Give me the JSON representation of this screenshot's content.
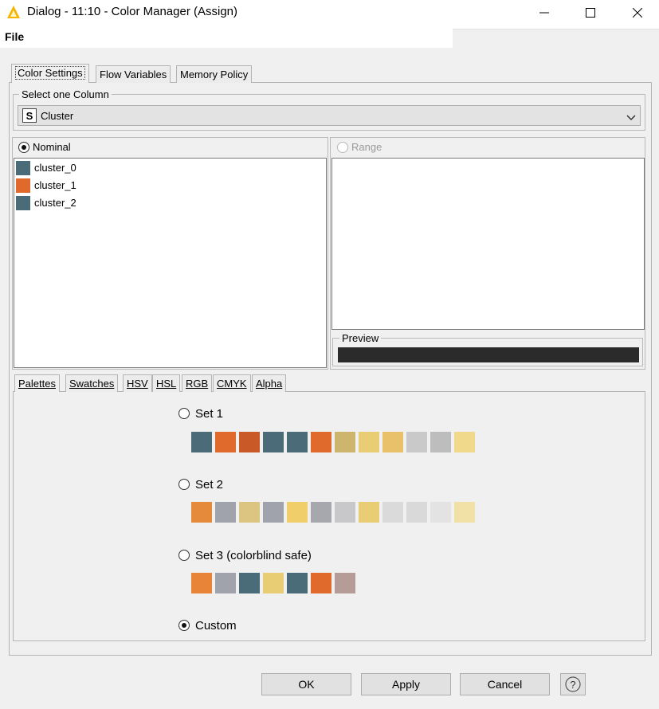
{
  "window": {
    "title": "Dialog - 11:10 - Color Manager (Assign)",
    "controls": [
      "minimize-icon",
      "maximize-icon",
      "close-icon"
    ]
  },
  "menu": {
    "file": "File"
  },
  "tabs": [
    {
      "label": "Color Settings",
      "active": true
    },
    {
      "label": "Flow Variables",
      "active": false
    },
    {
      "label": "Memory Policy",
      "active": false
    }
  ],
  "select_column": {
    "label": "Select one Column",
    "type_badge": "S",
    "value": "Cluster"
  },
  "nominal": {
    "label": "Nominal",
    "selected": true,
    "items": [
      {
        "label": "cluster_0",
        "color": "#4a6b78"
      },
      {
        "label": "cluster_1",
        "color": "#e06a2c"
      },
      {
        "label": "cluster_2",
        "color": "#4a6b78"
      }
    ]
  },
  "range": {
    "label": "Range",
    "selected": false,
    "enabled": false
  },
  "preview": {
    "label": "Preview",
    "color": "#2b2b2b"
  },
  "chooser_tabs": [
    "Palettes",
    "Swatches",
    "HSV",
    "HSL",
    "RGB",
    "CMYK",
    "Alpha"
  ],
  "palettes": [
    {
      "label": "Set 1",
      "selected": false,
      "colors": [
        "#4b6b78",
        "#e06a2c",
        "#c95a28",
        "#4b6b78",
        "#4b6b78",
        "#e06a2c",
        "#cdb56e",
        "#e9cd74",
        "#e8c16a",
        "#c9c9c9",
        "#bdbdbd",
        "#f0d98a"
      ]
    },
    {
      "label": "Set 2",
      "selected": false,
      "colors": [
        "#e58a3a",
        "#a0a3ab",
        "#dcc481",
        "#a0a3ab",
        "#f0cf6a",
        "#a7a8ae",
        "#c8c8cb",
        "#e9cd74",
        "#dadada",
        "#d9d9d9",
        "#e3e3e3",
        "#f2e1a6"
      ]
    },
    {
      "label": "Set 3 (colorblind safe)",
      "selected": false,
      "colors": [
        "#e88437",
        "#a0a3ab",
        "#4a6b78",
        "#e9cd74",
        "#4a6b78",
        "#e06a2c",
        "#b59c96"
      ]
    },
    {
      "label": "Custom",
      "selected": true,
      "colors": []
    }
  ],
  "buttons": {
    "ok": "OK",
    "apply": "Apply",
    "cancel": "Cancel",
    "help": "?"
  }
}
